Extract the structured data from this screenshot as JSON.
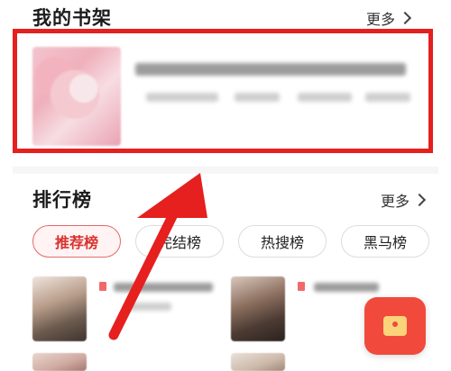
{
  "bookshelf": {
    "title": "我的书架",
    "more_label": "更多"
  },
  "ranking": {
    "title": "排行榜",
    "more_label": "更多",
    "tabs": [
      {
        "label": "推荐榜",
        "active": true
      },
      {
        "label": "完结榜",
        "active": false
      },
      {
        "label": "热搜榜",
        "active": false
      },
      {
        "label": "黑马榜",
        "active": false
      }
    ]
  },
  "colors": {
    "highlight": "#e5201e",
    "active_tab": "#d8322e",
    "floating_button": "#f14a3d"
  },
  "icons": {
    "more": "chevron-right-icon",
    "floating": "gift-icon",
    "annotation": "red-arrow"
  }
}
